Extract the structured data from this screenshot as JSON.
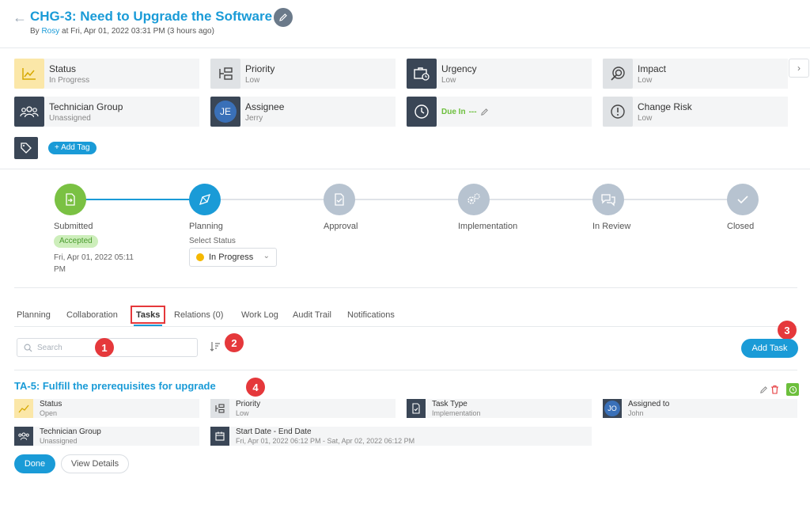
{
  "header": {
    "title": "CHG-3: Need to Upgrade the Software",
    "by_prefix": "By",
    "author": "Rosy",
    "timestamp": "at Fri, Apr 01, 2022 03:31 PM (3 hours ago)"
  },
  "fields": {
    "status": {
      "label": "Status",
      "value": "In Progress"
    },
    "priority": {
      "label": "Priority",
      "value": "Low"
    },
    "urgency": {
      "label": "Urgency",
      "value": "Low"
    },
    "impact": {
      "label": "Impact",
      "value": "Low"
    },
    "technician_group": {
      "label": "Technician Group",
      "value": "Unassigned"
    },
    "assignee": {
      "label": "Assignee",
      "value": "Jerry",
      "initials": "JE"
    },
    "due_in": {
      "label": "Due In",
      "value": "---"
    },
    "change_risk": {
      "label": "Change Risk",
      "value": "Low"
    }
  },
  "tags": {
    "add_label": "+ Add Tag"
  },
  "pipeline": {
    "stages": [
      {
        "name": "Submitted"
      },
      {
        "name": "Planning"
      },
      {
        "name": "Approval"
      },
      {
        "name": "Implementation"
      },
      {
        "name": "In Review"
      },
      {
        "name": "Closed"
      }
    ],
    "submitted_badge": "Accepted",
    "submitted_date": "Fri, Apr 01, 2022 05:11 PM",
    "select_status_label": "Select Status",
    "selected_status": "In Progress",
    "colors": {
      "done": "#7ac143",
      "current": "#1a9bd7",
      "pending": "#b7c3d0"
    }
  },
  "tabs": [
    "Planning",
    "Collaboration",
    "Tasks",
    "Relations (0)",
    "Work Log",
    "Audit Trail",
    "Notifications"
  ],
  "tasks_toolbar": {
    "search_placeholder": "Search",
    "add_task_label": "Add Task"
  },
  "annotations": [
    "1",
    "2",
    "3",
    "4"
  ],
  "task": {
    "title": "TA-5: Fulfill the prerequisites for upgrade",
    "status": {
      "label": "Status",
      "value": "Open"
    },
    "priority": {
      "label": "Priority",
      "value": "Low"
    },
    "task_type": {
      "label": "Task Type",
      "value": "Implementation"
    },
    "assigned_to": {
      "label": "Assigned to",
      "value": "John",
      "initials": "JO"
    },
    "technician_group": {
      "label": "Technician Group",
      "value": "Unassigned"
    },
    "dates": {
      "label": "Start Date - End Date",
      "value": "Fri, Apr 01, 2022 06:12 PM - Sat, Apr 02, 2022 06:12 PM"
    },
    "done_label": "Done",
    "view_details_label": "View Details"
  }
}
